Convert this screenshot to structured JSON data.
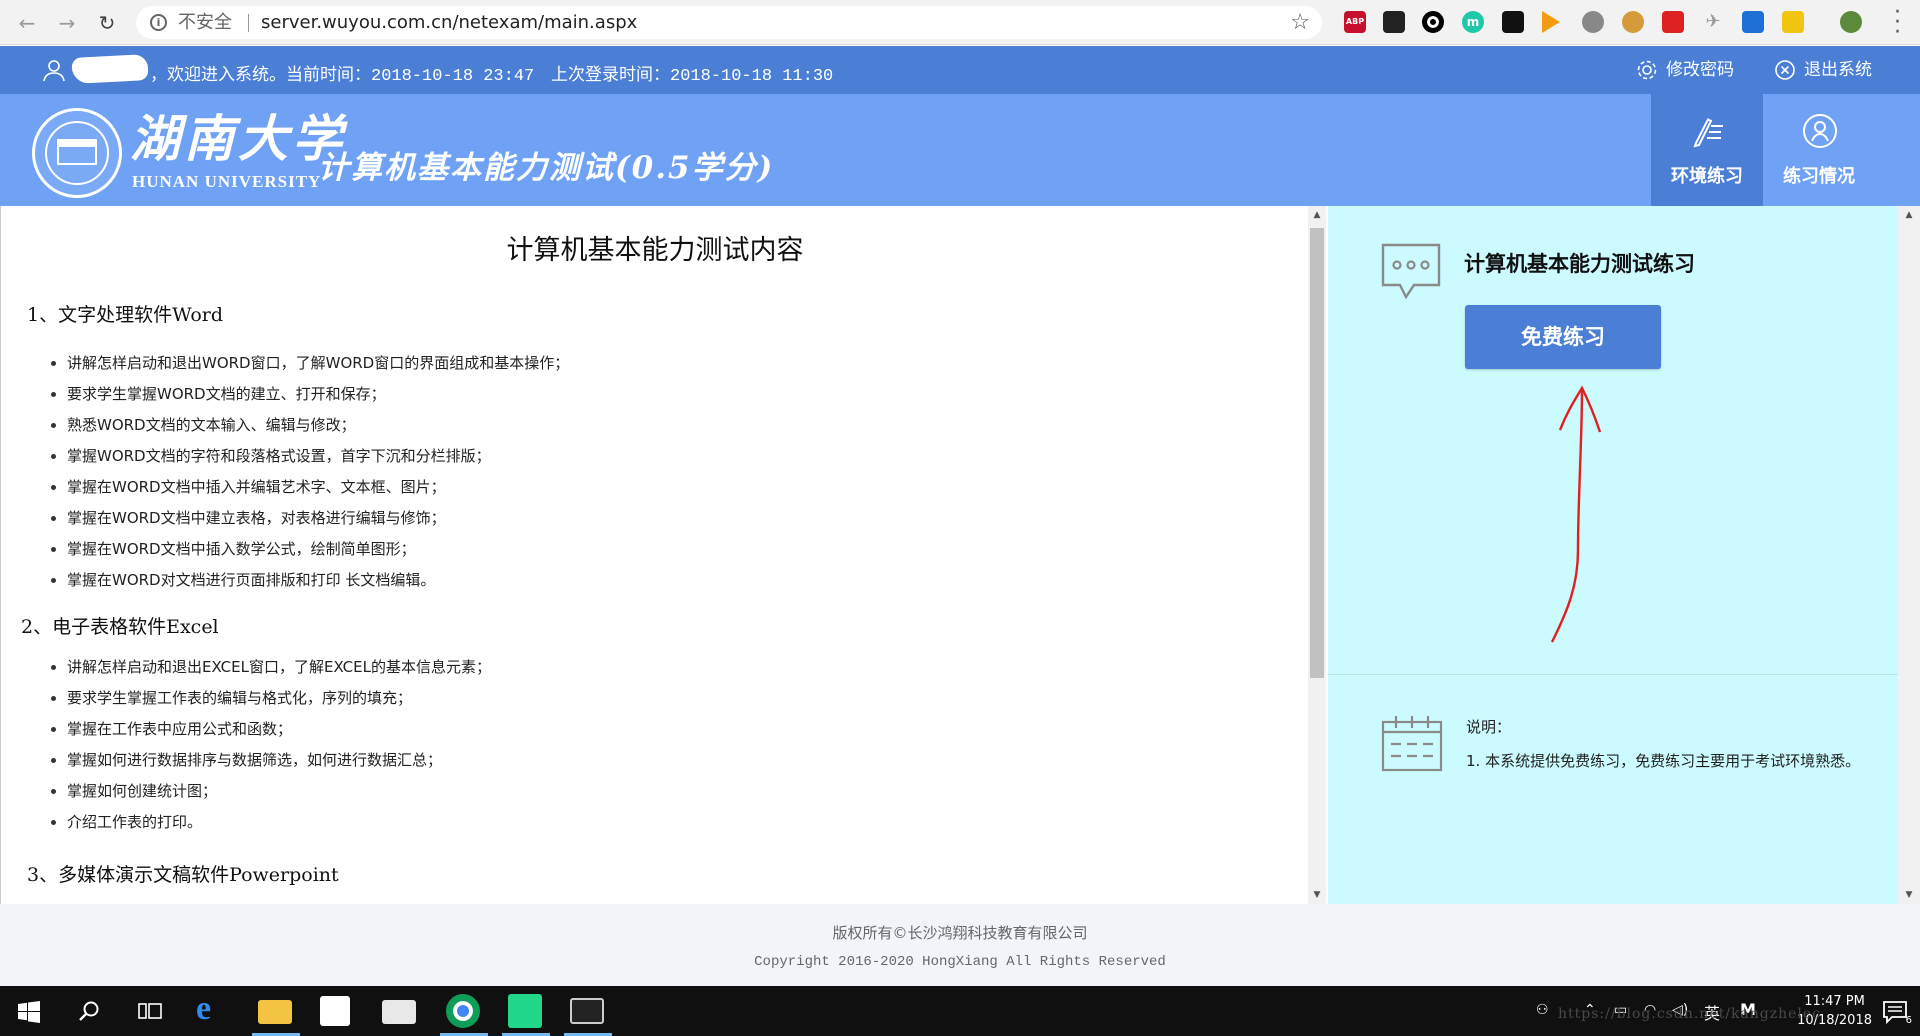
{
  "browser": {
    "security_label": "不安全",
    "url": "server.wuyou.com.cn/netexam/main.aspx",
    "back_icon": "←",
    "forward_icon": "→",
    "reload_icon": "↻",
    "info_icon": "i",
    "star_icon": "☆",
    "ext_abp": "ABP",
    "ext_m": "m"
  },
  "topbar": {
    "welcome": "，欢迎进入系统。当前时间：2018-10-18 23:47",
    "last_login": "上次登录时间：2018-10-18 11:30",
    "change_password": "修改密码",
    "logout": "退出系统"
  },
  "banner": {
    "logo_cn": "湖南大学",
    "logo_en": "HUNAN UNIVERSITY",
    "title": "计算机基本能力测试(0.5学分)",
    "tabs": [
      {
        "label": "环境练习",
        "active": true
      },
      {
        "label": "练习情况",
        "active": false
      }
    ]
  },
  "content": {
    "title": "计算机基本能力测试内容",
    "sections": [
      {
        "heading": "1、文字处理软件Word",
        "items": [
          "讲解怎样启动和退出WORD窗口，了解WORD窗口的界面组成和基本操作；",
          "要求学生掌握WORD文档的建立、打开和保存；",
          "熟悉WORD文档的文本输入、编辑与修改；",
          "掌握WORD文档的字符和段落格式设置，首字下沉和分栏排版；",
          "掌握在WORD文档中插入并编辑艺术字、文本框、图片；",
          "掌握在WORD文档中建立表格，对表格进行编辑与修饰；",
          "掌握在WORD文档中插入数学公式，绘制简单图形；",
          "掌握在WORD对文档进行页面排版和打印 长文档编辑。"
        ]
      },
      {
        "heading": "2、电子表格软件Excel",
        "items": [
          "讲解怎样启动和退出EXCEL窗口，了解EXCEL的基本信息元素；",
          "要求学生掌握工作表的编辑与格式化，序列的填充；",
          "掌握在工作表中应用公式和函数；",
          "掌握如何进行数据排序与数据筛选，如何进行数据汇总；",
          "掌握如何创建统计图；",
          "介绍工作表的打印。"
        ]
      },
      {
        "heading": "3、多媒体演示文稿软件Powerpoint",
        "items": []
      }
    ]
  },
  "practice": {
    "title": "计算机基本能力测试练习",
    "button": "免费练习",
    "note_label": "说明：",
    "note_text": "1. 本系统提供免费练习，免费练习主要用于考试环境熟悉。"
  },
  "footer": {
    "line1": "版权所有©长沙鸿翔科技教育有限公司",
    "line2": "Copyright 2016-2020 HongXiang All Rights Reserved"
  },
  "taskbar": {
    "ime": "英",
    "ime2": "M",
    "time": "11:47 PM",
    "date": "10/18/2018",
    "notification_count": "6"
  },
  "watermark": "https://blog.csdn.net/kangzhelec",
  "colors": {
    "header_blue": "#4a7fd5",
    "banner_blue": "#6fa2f5",
    "right_panel": "#ccfbff",
    "annotation_red": "#e02020"
  }
}
